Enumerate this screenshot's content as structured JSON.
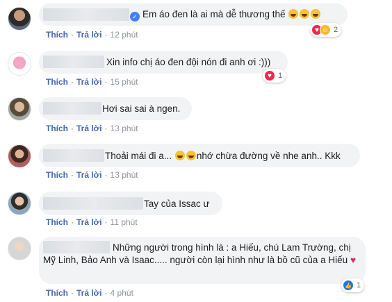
{
  "ui": {
    "like_label": "Thích",
    "reply_label": "Trả lời",
    "separator": "·",
    "verified_glyph": "✓",
    "love_glyph": "♥",
    "haha_glyph": "☺",
    "like_glyph": "👍",
    "heart_glyph": "♥"
  },
  "comments": [
    {
      "text": "Em áo đen là ai mà dễ thương thế",
      "time": "12 phút",
      "reaction_count": "2"
    },
    {
      "text": "Xin info chị áo đen đội nón đi anh ơi :)))",
      "time": "15 phút",
      "reaction_count": "1"
    },
    {
      "text": "Hơi sai sai à ngen.",
      "time": "13 phút"
    },
    {
      "text_before": "Thoải mái đi a...",
      "text_after": "nhớ chừa đường về nhe anh.. Kkk",
      "time": "13 phút"
    },
    {
      "text": "Tay của Issac ư",
      "time": "11 phút"
    },
    {
      "text": "Những người trong hình là : a Hiếu, chú Lam Trường, chị Mỹ Linh, Bảo Anh và Isaac..... người còn lại hình như là bồ cũ của a Hiếu",
      "time": "4 phút",
      "reaction_count": "1"
    }
  ]
}
